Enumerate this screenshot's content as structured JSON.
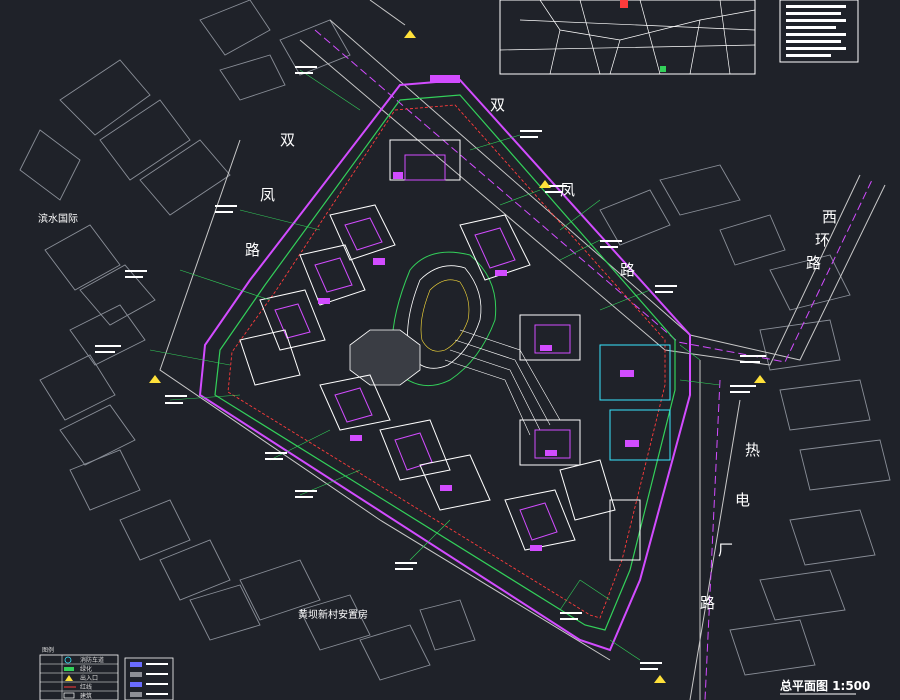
{
  "drawing": {
    "title": "总平面图 1:500",
    "labels": {
      "binshui": "滨水国际",
      "huangba": "黄坝新村安置房"
    },
    "roads": {
      "left": [
        "双",
        "凤",
        "路"
      ],
      "right": [
        "双",
        "凤",
        "路"
      ],
      "xihuan": [
        "西",
        "环",
        "路"
      ],
      "redian": [
        "热",
        "电",
        "厂",
        "路"
      ]
    },
    "colors": {
      "background": "#1f2229",
      "site_boundary": "#d24cff",
      "landscape": "#33d05a",
      "building": "#ffffff",
      "accent_red": "#ff3b3b",
      "accent_yellow": "#ffe13a",
      "accent_cyan": "#39e6ff"
    }
  },
  "legend": {
    "title": "图例",
    "rows": [
      {
        "icon": "circle-icon",
        "text": "消防车道"
      },
      {
        "icon": "hatch-icon",
        "text": "绿化"
      },
      {
        "icon": "triangle-icon",
        "text": "出入口"
      },
      {
        "icon": "line-icon",
        "text": "红线"
      },
      {
        "icon": "rect-icon",
        "text": "建筑"
      }
    ]
  }
}
